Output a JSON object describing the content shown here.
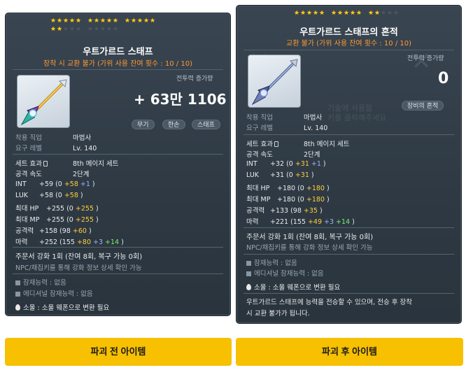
{
  "left": {
    "stars_filled": 17,
    "stars_total": 25,
    "title": "우트가르드 스태프",
    "subtitle": "장착 시 교환 불가 (가위 사용 잔여 횟수 : 10 / 10)",
    "power_label": "전투력 증가량",
    "power_value": "+ 63만 1106",
    "tags": [
      "무기",
      "한손",
      "스태프"
    ],
    "job_label": "착용 직업",
    "job_value": "마법사",
    "level_label": "요구 레벨",
    "level_value": "Lv. 140",
    "set_label": "세트 효과",
    "set_value": "8th 메이지 세트",
    "speed_label": "공격 속도",
    "speed_value": "2단계",
    "stats": [
      {
        "name": "INT",
        "total": "+59",
        "open": "(0",
        "a": "+58",
        "b": "+1",
        "close": ")"
      },
      {
        "name": "LUK",
        "total": "+58",
        "open": "(0",
        "a": "+58",
        "close": ")"
      },
      {
        "name": "최대 HP",
        "total": "+255",
        "open": "(0",
        "a": "+255",
        "close": ")"
      },
      {
        "name": "최대 MP",
        "total": "+255",
        "open": "(0",
        "a": "+255",
        "close": ")"
      },
      {
        "name": "공격력",
        "total": "+158",
        "open": "(98",
        "a": "+60",
        "close": ")"
      },
      {
        "name": "마력",
        "total": "+252",
        "open": "(155",
        "a": "+80",
        "b": "+3",
        "c": "+14",
        "close": ")"
      }
    ],
    "upgrade": "주문서 강화 1회 (잔여 8회, 복구 가능 0회)",
    "upgrade_note": "NPC/채집키를 통해 강화 정보 상세 확인 가능",
    "potential": "잠재능력 : 없음",
    "additional": "에디셔널 잠재능력 : 없음",
    "soul": "소울 : 소울 웨폰으로 변환 필요"
  },
  "right": {
    "stars_filled": 12,
    "stars_total": 15,
    "title": "우트가르드 스태프의 흔적",
    "subtitle": "교환 불가 (가위 사용 잔여 횟수 : 10 / 10)",
    "power_label": "전투력 증가량",
    "power_value": "0",
    "tag": "장비의 흔적",
    "job_label": "착용 직업",
    "job_value": "마법사",
    "level_label": "요구 레벨",
    "level_value": "Lv. 140",
    "set_label": "세트 효과",
    "set_value": "8th 메이지 세트",
    "speed_label": "공격 속도",
    "speed_value": "2단계",
    "stats": [
      {
        "name": "INT",
        "total": "+32",
        "open": "(0",
        "a": "+31",
        "b": "+1",
        "close": ")"
      },
      {
        "name": "LUK",
        "total": "+31",
        "open": "(0",
        "a": "+31",
        "close": ")"
      },
      {
        "name": "최대 HP",
        "total": "+180",
        "open": "(0",
        "a": "+180",
        "close": ")"
      },
      {
        "name": "최대 MP",
        "total": "+180",
        "open": "(0",
        "a": "+180",
        "close": ")"
      },
      {
        "name": "공격력",
        "total": "+133",
        "open": "(98",
        "a": "+35",
        "close": ")"
      },
      {
        "name": "마력",
        "total": "+221",
        "open": "(155",
        "a": "+49",
        "b": "+3",
        "c": "+14",
        "close": ")"
      }
    ],
    "upgrade": "주문서 강화 1회 (잔여 8회, 복구 가능 0회)",
    "upgrade_note": "NPC/채집키를 통해 강화 정보 상세 확인 가능",
    "potential": "잠재능력 : 없음",
    "additional": "에디셔널 잠재능력 : 없음",
    "soul": "소울 : 소울 웨폰으로 변환 필요",
    "desc_line1": "우트가르드 스태프에 능력을 전승할 수 있으며, 전승 후 장착",
    "desc_line2": "시 교환 불가가 됩니다."
  },
  "buttons": {
    "before": "파괴 전 아이템",
    "after": "파괴 후 아이템"
  },
  "colors": {
    "star_on": "#ffcc1a",
    "subtitle": "#ff9a2e",
    "button": "#f7c000",
    "stat_yellow": "#ffcf3c",
    "stat_green": "#7df06e"
  },
  "icons": [
    "staff-item-icon",
    "lock-icon",
    "flame-icon",
    "potential-square-icon"
  ]
}
